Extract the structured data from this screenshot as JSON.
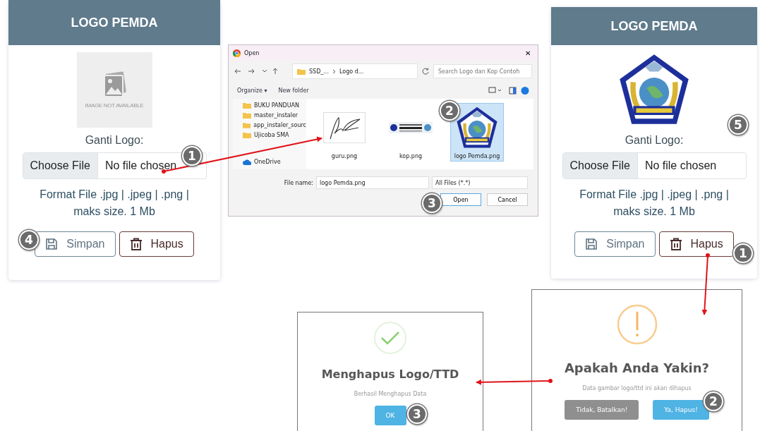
{
  "cards": [
    {
      "title": "LOGO PEMDA",
      "image": {
        "kind": "placeholder",
        "caption": "IMAGE NOT AVAILABLE"
      },
      "label": "Ganti Logo:",
      "choose_button": "Choose File",
      "file_status": "No file chosen",
      "hint": "Format File .jpg | .jpeg | .png | maks size. 1 Mb",
      "buttons": [
        {
          "kind": "save",
          "label": "Simpan"
        },
        {
          "kind": "delete",
          "label": "Hapus"
        }
      ]
    },
    {
      "title": "LOGO PEMDA",
      "image": {
        "kind": "emblem"
      },
      "label": "Ganti Logo:",
      "choose_button": "Choose File",
      "file_status": "No file chosen",
      "hint": "Format File .jpg | .jpeg | .png | maks size. 1 Mb",
      "buttons": [
        {
          "kind": "save",
          "label": "Simpan"
        },
        {
          "kind": "delete",
          "label": "Hapus"
        }
      ]
    }
  ],
  "open_dialog": {
    "title": "Open",
    "close": "✕",
    "path": [
      "SSD_...",
      "Logo d..."
    ],
    "search": {
      "placeholder": "Search Logo dan Kop Contoh"
    },
    "toolbar": [
      "Organize ▾",
      "New folder"
    ],
    "nav": [
      {
        "kind": "folder",
        "label": "BUKU PANDUAN"
      },
      {
        "kind": "folder",
        "label": "master_instaler"
      },
      {
        "kind": "folder",
        "label": "app_instaler_sourc"
      },
      {
        "kind": "folder",
        "label": "Ujicoba SMA"
      },
      {
        "kind": "cloud",
        "label": "OneDrive"
      }
    ],
    "files": [
      {
        "kind": "signature",
        "name": "guru.png",
        "selected": false
      },
      {
        "kind": "letterhead",
        "name": "kop.png",
        "selected": false
      },
      {
        "kind": "emblem",
        "name": "logo Pemda.png",
        "selected": true
      }
    ],
    "file_name_label": "File name:",
    "file_name": "logo Pemda.png",
    "filter": "All Files (*.*)",
    "buttons": [
      "Open",
      "Cancel"
    ]
  },
  "confirm_dialog": {
    "kind": "warning",
    "title": "Apakah Anda Yakin?",
    "text": "Data gambar logo/ttd ini akan dihapus",
    "buttons": [
      {
        "kind": "cancel",
        "label": "Tidak, Batalkan!"
      },
      {
        "kind": "confirm",
        "label": "Ya, Hapus!"
      }
    ]
  },
  "success_dialog": {
    "kind": "success",
    "title": "Menghapus Logo/TTD",
    "text": "Berhasil Menghapus Data",
    "buttons": [
      {
        "kind": "confirm",
        "label": "OK"
      }
    ]
  },
  "step_markers": [
    "1",
    "4",
    "2",
    "3",
    "5",
    "1",
    "2",
    "3"
  ]
}
